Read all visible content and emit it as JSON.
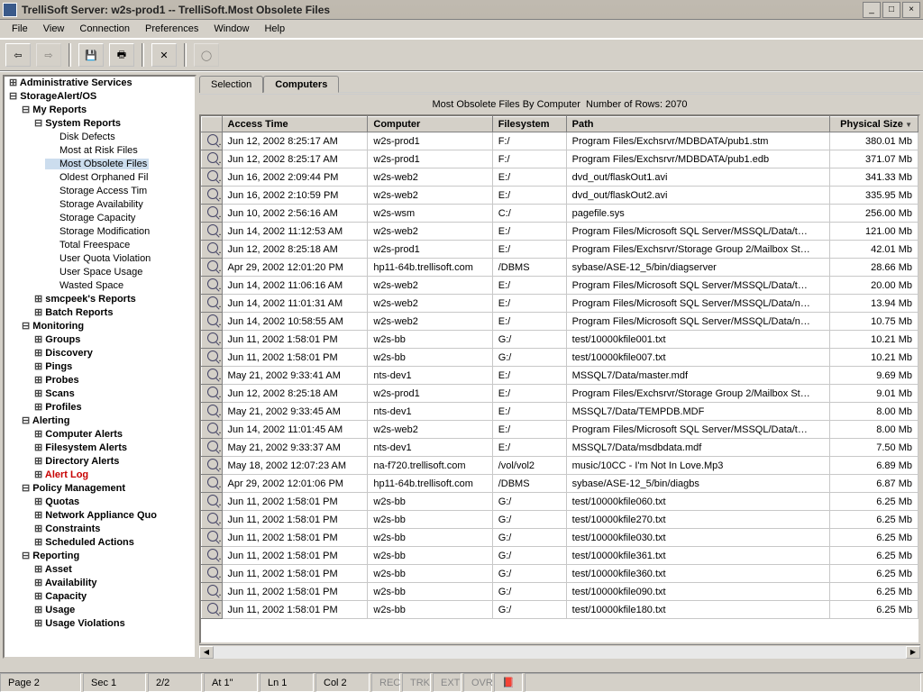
{
  "window": {
    "title": "TrelliSoft Server:  w2s-prod1 -- TrelliSoft.Most Obsolete Files"
  },
  "menu": [
    "File",
    "View",
    "Connection",
    "Preferences",
    "Window",
    "Help"
  ],
  "tree": [
    {
      "t": "node-closed bold",
      "l": "Administrative Services"
    },
    {
      "t": "node bold",
      "l": "StorageAlert/OS",
      "c": [
        {
          "t": "node bold",
          "l": "My Reports",
          "c": [
            {
              "t": "node bold",
              "l": "System Reports",
              "c": [
                {
                  "t": "leaf",
                  "l": "Disk Defects"
                },
                {
                  "t": "leaf",
                  "l": "Most at Risk Files"
                },
                {
                  "t": "leaf sel",
                  "l": "Most Obsolete Files"
                },
                {
                  "t": "leaf",
                  "l": "Oldest Orphaned Fil"
                },
                {
                  "t": "leaf",
                  "l": "Storage Access Tim"
                },
                {
                  "t": "leaf",
                  "l": "Storage Availability"
                },
                {
                  "t": "leaf",
                  "l": "Storage Capacity"
                },
                {
                  "t": "leaf",
                  "l": "Storage Modification"
                },
                {
                  "t": "leaf",
                  "l": "Total Freespace"
                },
                {
                  "t": "leaf",
                  "l": "User Quota Violation"
                },
                {
                  "t": "leaf",
                  "l": "User Space Usage"
                },
                {
                  "t": "leaf",
                  "l": "Wasted Space"
                }
              ]
            },
            {
              "t": "node-closed bold",
              "l": "smcpeek's Reports"
            },
            {
              "t": "node-closed bold",
              "l": "Batch Reports"
            }
          ]
        },
        {
          "t": "node bold",
          "l": "Monitoring",
          "c": [
            {
              "t": "node-closed bold",
              "l": "Groups"
            },
            {
              "t": "node-closed bold",
              "l": "Discovery"
            },
            {
              "t": "node-closed bold",
              "l": "Pings"
            },
            {
              "t": "node-closed bold",
              "l": "Probes"
            },
            {
              "t": "node-closed bold",
              "l": "Scans"
            },
            {
              "t": "node-closed bold",
              "l": "Profiles"
            }
          ]
        },
        {
          "t": "node bold",
          "l": "Alerting",
          "c": [
            {
              "t": "node-closed bold",
              "l": "Computer Alerts"
            },
            {
              "t": "node-closed bold",
              "l": "Filesystem Alerts"
            },
            {
              "t": "node-closed bold",
              "l": "Directory Alerts"
            },
            {
              "t": "node-closed bold red",
              "l": "Alert Log"
            }
          ]
        },
        {
          "t": "node bold",
          "l": "Policy Management",
          "c": [
            {
              "t": "node-closed bold",
              "l": "Quotas"
            },
            {
              "t": "node-closed bold",
              "l": "Network Appliance Quo"
            },
            {
              "t": "node-closed bold",
              "l": "Constraints"
            },
            {
              "t": "node-closed bold",
              "l": "Scheduled Actions"
            }
          ]
        },
        {
          "t": "node bold",
          "l": "Reporting",
          "c": [
            {
              "t": "node-closed bold",
              "l": "Asset"
            },
            {
              "t": "node-closed bold",
              "l": "Availability"
            },
            {
              "t": "node-closed bold",
              "l": "Capacity"
            },
            {
              "t": "node-closed bold",
              "l": "Usage"
            },
            {
              "t": "node-closed bold",
              "l": "Usage Violations"
            }
          ]
        }
      ]
    }
  ],
  "tabs": {
    "items": [
      "Selection",
      "Computers"
    ],
    "active": 1
  },
  "caption": {
    "title": "Most Obsolete Files By Computer",
    "rowcount": "Number of Rows: 2070"
  },
  "columns": [
    {
      "key": "time",
      "label": "Access Time",
      "cls": "c-time"
    },
    {
      "key": "comp",
      "label": "Computer",
      "cls": "c-comp"
    },
    {
      "key": "fs",
      "label": "Filesystem",
      "cls": "c-fs"
    },
    {
      "key": "path",
      "label": "Path",
      "cls": "c-path"
    },
    {
      "key": "size",
      "label": "Physical Size",
      "cls": "c-sz right",
      "sort": true
    }
  ],
  "rows": [
    {
      "time": "Jun 12, 2002 8:25:17 AM",
      "comp": "w2s-prod1",
      "fs": "F:/",
      "path": "Program Files/Exchsrvr/MDBDATA/pub1.stm",
      "size": "380.01 Mb"
    },
    {
      "time": "Jun 12, 2002 8:25:17 AM",
      "comp": "w2s-prod1",
      "fs": "F:/",
      "path": "Program Files/Exchsrvr/MDBDATA/pub1.edb",
      "size": "371.07 Mb"
    },
    {
      "time": "Jun 16, 2002 2:09:44 PM",
      "comp": "w2s-web2",
      "fs": "E:/",
      "path": "dvd_out/flaskOut1.avi",
      "size": "341.33 Mb"
    },
    {
      "time": "Jun 16, 2002 2:10:59 PM",
      "comp": "w2s-web2",
      "fs": "E:/",
      "path": "dvd_out/flaskOut2.avi",
      "size": "335.95 Mb"
    },
    {
      "time": "Jun 10, 2002 2:56:16 AM",
      "comp": "w2s-wsm",
      "fs": "C:/",
      "path": "pagefile.sys",
      "size": "256.00 Mb"
    },
    {
      "time": "Jun 14, 2002 11:12:53 AM",
      "comp": "w2s-web2",
      "fs": "E:/",
      "path": "Program Files/Microsoft SQL Server/MSSQL/Data/t…",
      "size": "121.00 Mb"
    },
    {
      "time": "Jun 12, 2002 8:25:18 AM",
      "comp": "w2s-prod1",
      "fs": "E:/",
      "path": "Program Files/Exchsrvr/Storage Group 2/Mailbox St…",
      "size": "42.01 Mb"
    },
    {
      "time": "Apr 29, 2002 12:01:20 PM",
      "comp": "hp11-64b.trellisoft.com",
      "fs": "/DBMS",
      "path": "sybase/ASE-12_5/bin/diagserver",
      "size": "28.66 Mb"
    },
    {
      "time": "Jun 14, 2002 11:06:16 AM",
      "comp": "w2s-web2",
      "fs": "E:/",
      "path": "Program Files/Microsoft SQL Server/MSSQL/Data/t…",
      "size": "20.00 Mb"
    },
    {
      "time": "Jun 14, 2002 11:01:31 AM",
      "comp": "w2s-web2",
      "fs": "E:/",
      "path": "Program Files/Microsoft SQL Server/MSSQL/Data/n…",
      "size": "13.94 Mb"
    },
    {
      "time": "Jun 14, 2002 10:58:55 AM",
      "comp": "w2s-web2",
      "fs": "E:/",
      "path": "Program Files/Microsoft SQL Server/MSSQL/Data/n…",
      "size": "10.75 Mb"
    },
    {
      "time": "Jun 11, 2002 1:58:01 PM",
      "comp": "w2s-bb",
      "fs": "G:/",
      "path": "test/10000kfile001.txt",
      "size": "10.21 Mb"
    },
    {
      "time": "Jun 11, 2002 1:58:01 PM",
      "comp": "w2s-bb",
      "fs": "G:/",
      "path": "test/10000kfile007.txt",
      "size": "10.21 Mb"
    },
    {
      "time": "May 21, 2002 9:33:41 AM",
      "comp": "nts-dev1",
      "fs": "E:/",
      "path": "MSSQL7/Data/master.mdf",
      "size": "9.69 Mb"
    },
    {
      "time": "Jun 12, 2002 8:25:18 AM",
      "comp": "w2s-prod1",
      "fs": "E:/",
      "path": "Program Files/Exchsrvr/Storage Group 2/Mailbox St…",
      "size": "9.01 Mb"
    },
    {
      "time": "May 21, 2002 9:33:45 AM",
      "comp": "nts-dev1",
      "fs": "E:/",
      "path": "MSSQL7/Data/TEMPDB.MDF",
      "size": "8.00 Mb"
    },
    {
      "time": "Jun 14, 2002 11:01:45 AM",
      "comp": "w2s-web2",
      "fs": "E:/",
      "path": "Program Files/Microsoft SQL Server/MSSQL/Data/t…",
      "size": "8.00 Mb"
    },
    {
      "time": "May 21, 2002 9:33:37 AM",
      "comp": "nts-dev1",
      "fs": "E:/",
      "path": "MSSQL7/Data/msdbdata.mdf",
      "size": "7.50 Mb"
    },
    {
      "time": "May 18, 2002 12:07:23 AM",
      "comp": "na-f720.trellisoft.com",
      "fs": "/vol/vol2",
      "path": "music/10CC - I'm Not In Love.Mp3",
      "size": "6.89 Mb"
    },
    {
      "time": "Apr 29, 2002 12:01:06 PM",
      "comp": "hp11-64b.trellisoft.com",
      "fs": "/DBMS",
      "path": "sybase/ASE-12_5/bin/diagbs",
      "size": "6.87 Mb"
    },
    {
      "time": "Jun 11, 2002 1:58:01 PM",
      "comp": "w2s-bb",
      "fs": "G:/",
      "path": "test/10000kfile060.txt",
      "size": "6.25 Mb"
    },
    {
      "time": "Jun 11, 2002 1:58:01 PM",
      "comp": "w2s-bb",
      "fs": "G:/",
      "path": "test/10000kfile270.txt",
      "size": "6.25 Mb"
    },
    {
      "time": "Jun 11, 2002 1:58:01 PM",
      "comp": "w2s-bb",
      "fs": "G:/",
      "path": "test/10000kfile030.txt",
      "size": "6.25 Mb"
    },
    {
      "time": "Jun 11, 2002 1:58:01 PM",
      "comp": "w2s-bb",
      "fs": "G:/",
      "path": "test/10000kfile361.txt",
      "size": "6.25 Mb"
    },
    {
      "time": "Jun 11, 2002 1:58:01 PM",
      "comp": "w2s-bb",
      "fs": "G:/",
      "path": "test/10000kfile360.txt",
      "size": "6.25 Mb"
    },
    {
      "time": "Jun 11, 2002 1:58:01 PM",
      "comp": "w2s-bb",
      "fs": "G:/",
      "path": "test/10000kfile090.txt",
      "size": "6.25 Mb"
    },
    {
      "time": "Jun 11, 2002 1:58:01 PM",
      "comp": "w2s-bb",
      "fs": "G:/",
      "path": "test/10000kfile180.txt",
      "size": "6.25 Mb"
    }
  ],
  "status": {
    "page": "Page 2",
    "sec": "Sec 1",
    "pages": "2/2",
    "at": "At 1\"",
    "ln": "Ln 1",
    "col": "Col 2",
    "flags": [
      "REC",
      "TRK",
      "EXT",
      "OVR"
    ]
  }
}
